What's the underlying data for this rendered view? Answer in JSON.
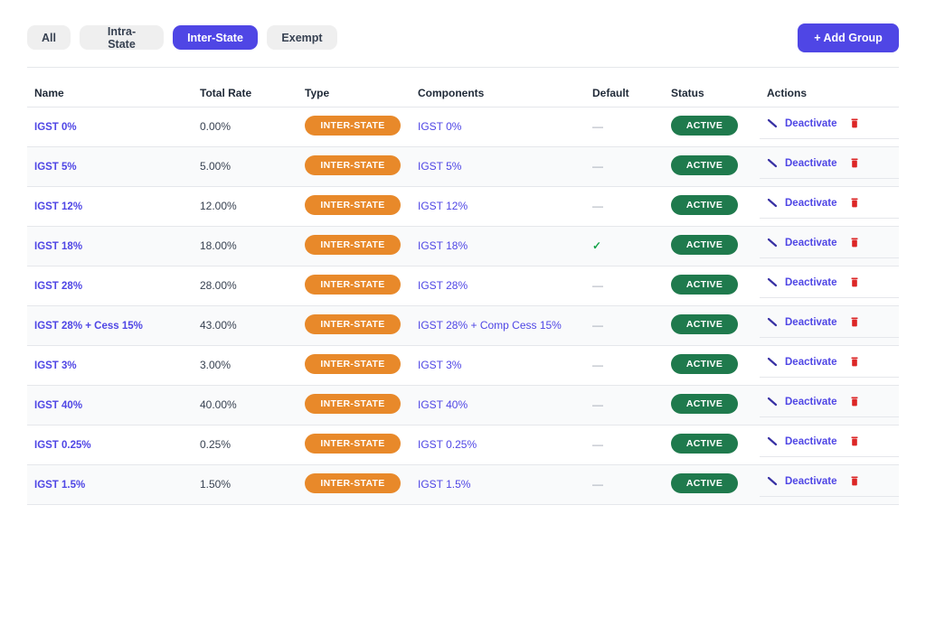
{
  "tabs": [
    "All",
    "Intra-State",
    "Inter-State",
    "Exempt"
  ],
  "active_tab": "Inter-State",
  "add_button": "+ Add Group",
  "columns": [
    "Name",
    "Total Rate",
    "Type",
    "Components",
    "Default",
    "Status",
    "Actions"
  ],
  "deactivate_label": "Deactivate",
  "colors": {
    "accent": "#4f46e5",
    "type_badge": "#e8892a",
    "status_badge": "#1f7a4d",
    "delete": "#dc2626"
  },
  "rows": [
    {
      "name": "IGST 0%",
      "rate": "0.00%",
      "type": "INTER-STATE",
      "components": "IGST 0%",
      "default": "—",
      "status": "ACTIVE"
    },
    {
      "name": "IGST 5%",
      "rate": "5.00%",
      "type": "INTER-STATE",
      "components": "IGST 5%",
      "default": "—",
      "status": "ACTIVE"
    },
    {
      "name": "IGST 12%",
      "rate": "12.00%",
      "type": "INTER-STATE",
      "components": "IGST 12%",
      "default": "—",
      "status": "ACTIVE"
    },
    {
      "name": "IGST 18%",
      "rate": "18.00%",
      "type": "INTER-STATE",
      "components": "IGST 18%",
      "default": "✓",
      "status": "ACTIVE"
    },
    {
      "name": "IGST 28%",
      "rate": "28.00%",
      "type": "INTER-STATE",
      "components": "IGST 28%",
      "default": "—",
      "status": "ACTIVE"
    },
    {
      "name": "IGST 28% + Cess 15%",
      "rate": "43.00%",
      "type": "INTER-STATE",
      "components": "IGST 28% + Comp Cess 15%",
      "default": "—",
      "status": "ACTIVE"
    },
    {
      "name": "IGST 3%",
      "rate": "3.00%",
      "type": "INTER-STATE",
      "components": "IGST 3%",
      "default": "—",
      "status": "ACTIVE"
    },
    {
      "name": "IGST 40%",
      "rate": "40.00%",
      "type": "INTER-STATE",
      "components": "IGST 40%",
      "default": "—",
      "status": "ACTIVE"
    },
    {
      "name": "IGST 0.25%",
      "rate": "0.25%",
      "type": "INTER-STATE",
      "components": "IGST 0.25%",
      "default": "—",
      "status": "ACTIVE"
    },
    {
      "name": "IGST 1.5%",
      "rate": "1.50%",
      "type": "INTER-STATE",
      "components": "IGST 1.5%",
      "default": "—",
      "status": "ACTIVE"
    }
  ]
}
